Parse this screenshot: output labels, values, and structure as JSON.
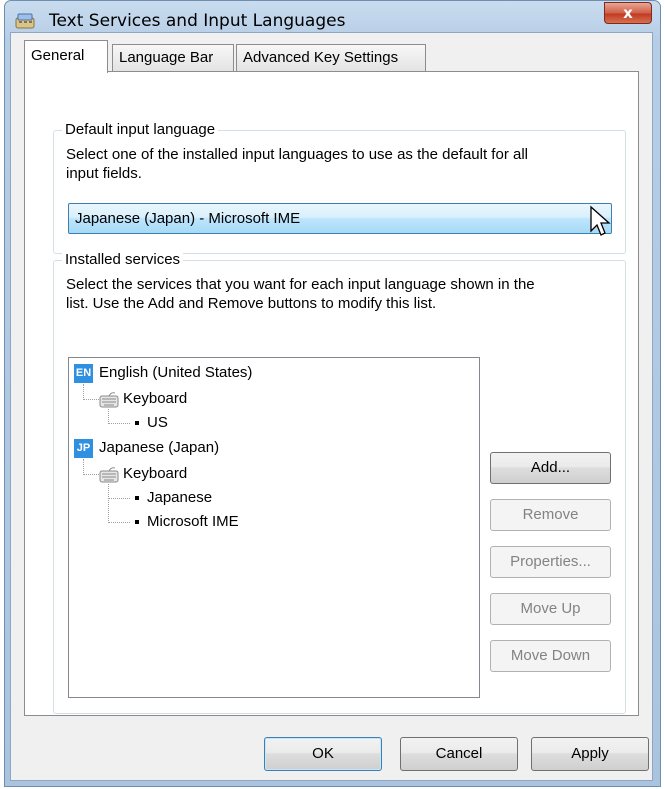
{
  "window": {
    "title": "Text Services and Input Languages",
    "close_label": "x"
  },
  "tabs": [
    {
      "label": "General",
      "active": true
    },
    {
      "label": "Language Bar",
      "active": false
    },
    {
      "label": "Advanced Key Settings",
      "active": false
    }
  ],
  "default_input": {
    "legend": "Default input language",
    "description_line1": "Select one of the installed input languages to use as the default for all",
    "description_line2": "input fields.",
    "selected": "Japanese (Japan) - Microsoft IME"
  },
  "installed": {
    "legend": "Installed services",
    "description_line1": "Select the services that you want for each input language shown in the",
    "description_line2": "list. Use the Add and Remove buttons to modify this list.",
    "tree": {
      "english": {
        "badge": "EN",
        "label": "English (United States)",
        "category": "Keyboard",
        "layouts": [
          "US"
        ]
      },
      "japanese": {
        "badge": "JP",
        "label": "Japanese (Japan)",
        "category": "Keyboard",
        "layouts": [
          "Japanese",
          "Microsoft IME"
        ]
      }
    },
    "buttons": {
      "add": "Add...",
      "remove": "Remove",
      "properties": "Properties...",
      "move_up": "Move Up",
      "move_down": "Move Down"
    }
  },
  "footer": {
    "ok": "OK",
    "cancel": "Cancel",
    "apply": "Apply"
  },
  "colors": {
    "en_badge": "#2f8fe0",
    "jp_badge": "#2f8fe0",
    "combo_highlight": "#bee6fd",
    "close_button": "#c23a22"
  }
}
